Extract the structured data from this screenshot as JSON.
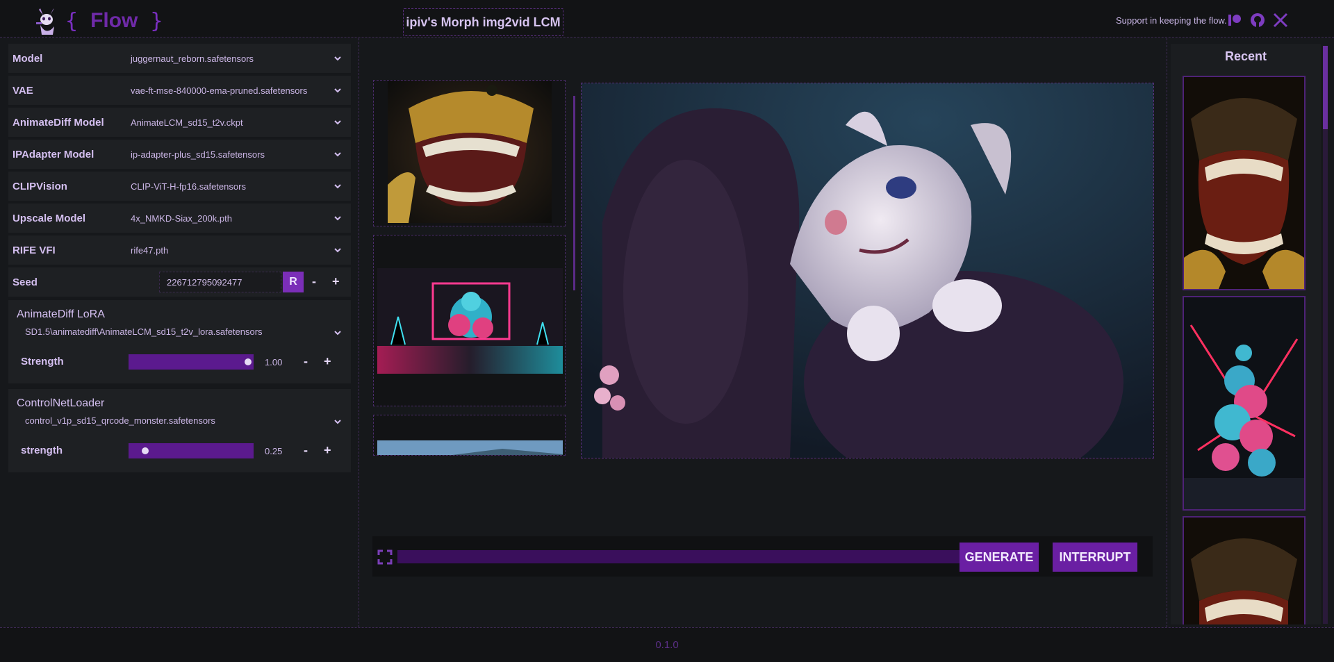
{
  "header": {
    "brand_open": "{",
    "brand_name": "Flow",
    "brand_close": "}",
    "app_title": "ipiv's Morph img2vid LCM",
    "support_text": "Support in keeping the flow.",
    "icons": [
      "patreon-icon",
      "github-icon",
      "x-icon"
    ]
  },
  "params": [
    {
      "label": "Model",
      "value": "juggernaut_reborn.safetensors"
    },
    {
      "label": "VAE",
      "value": "vae-ft-mse-840000-ema-pruned.safetensors"
    },
    {
      "label": "AnimateDiff Model",
      "value": "AnimateLCM_sd15_t2v.ckpt"
    },
    {
      "label": "IPAdapter Model",
      "value": "ip-adapter-plus_sd15.safetensors"
    },
    {
      "label": "CLIPVision",
      "value": "CLIP-ViT-H-fp16.safetensors"
    },
    {
      "label": "Upscale Model",
      "value": "4x_NMKD-Siax_200k.pth"
    },
    {
      "label": "RIFE VFI",
      "value": "rife47.pth"
    }
  ],
  "seed": {
    "label": "Seed",
    "value": "226712795092477",
    "random_label": "R",
    "minus": "-",
    "plus": "+"
  },
  "lora": {
    "title": "AnimateDiff LoRA",
    "select": "SD1.5\\animatediff\\AnimateLCM_sd15_t2v_lora.safetensors",
    "strength_label": "Strength",
    "strength_value": "1.00",
    "strength_fraction": 1.0,
    "minus": "-",
    "plus": "+"
  },
  "controlnet": {
    "title": "ControlNetLoader",
    "select": "control_v1p_sd15_qrcode_monster.safetensors",
    "strength_label": "strength",
    "strength_value": "0.25",
    "strength_fraction": 0.1,
    "minus": "-",
    "plus": "+"
  },
  "actions": {
    "generate": "GENERATE",
    "interrupt": "INTERRUPT",
    "progress": 0
  },
  "recent": {
    "title": "Recent"
  },
  "footer": {
    "version": "0.1.0"
  },
  "colors": {
    "accent": "#6a1fa3",
    "background": "#16181b",
    "text": "#d9c6f2"
  }
}
